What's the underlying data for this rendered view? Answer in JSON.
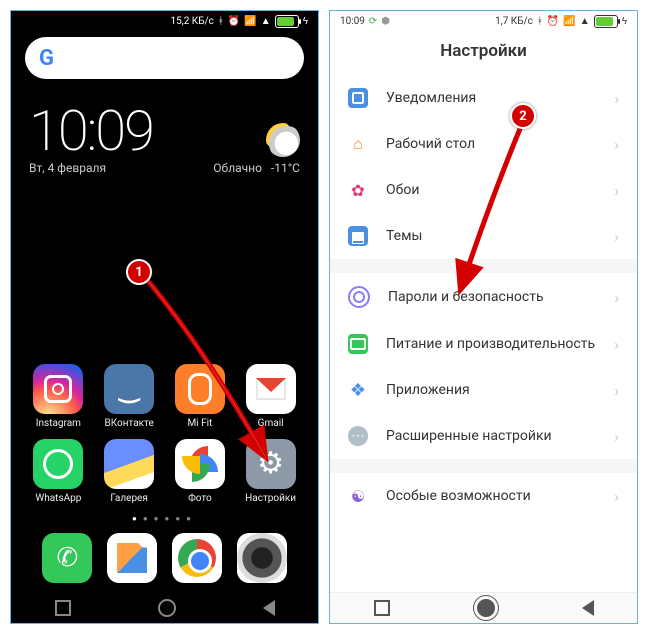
{
  "home": {
    "status": {
      "speed": "15,2 КБ/с"
    },
    "clock": {
      "time": "10:09",
      "date": "Вт, 4 февраля"
    },
    "weather": {
      "cond": "Облачно",
      "temp": "-11°C"
    },
    "apps": {
      "instagram": "Instagram",
      "vk": "ВКонтакте",
      "mifit": "Mi Fit",
      "gmail": "Gmail",
      "whatsapp": "WhatsApp",
      "gallery": "Галерея",
      "photos": "Фото",
      "settings": "Настройки"
    }
  },
  "settings": {
    "status": {
      "time": "10:09",
      "speed": "1,7 КБ/с"
    },
    "title": "Настройки",
    "items": {
      "notifications": "Уведомления",
      "desktop": "Рабочий стол",
      "wallpaper": "Обои",
      "themes": "Темы",
      "security": "Пароли и безопасность",
      "power": "Питание и производительность",
      "apps": "Приложения",
      "advanced": "Расширенные настройки",
      "accessibility": "Особые возможности"
    }
  },
  "markers": {
    "m1": "1",
    "m2": "2"
  }
}
